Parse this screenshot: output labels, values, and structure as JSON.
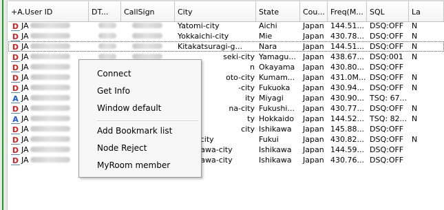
{
  "columns": [
    "+A.User ID",
    "DT...",
    "CallSign",
    "City",
    "State",
    "Cou...",
    "Freq(M...",
    "SQL",
    "La"
  ],
  "rows": [
    {
      "icon": "D",
      "id": "JA",
      "city": "Yatomi-city",
      "state": "Aichi",
      "country": "Japan",
      "freq": "144.51...",
      "sql": "DSQ:OFF",
      "last": "N"
    },
    {
      "icon": "D",
      "id": "JA",
      "city": "Yokkaichi-city",
      "state": "Mie",
      "country": "Japan",
      "freq": "430.78...",
      "sql": "DSQ:OFF",
      "last": "N"
    },
    {
      "icon": "D",
      "id": "JA",
      "city": "Kitakatsuragi-g...",
      "state": "Nara",
      "country": "Japan",
      "freq": "144.51...",
      "sql": "DSQ:OFF",
      "last": "N"
    },
    {
      "icon": "D",
      "id": "JA",
      "city": "seki-city",
      "state": "Yamagu...",
      "country": "Japan",
      "freq": "438.67...",
      "sql": "DSQ:001",
      "last": "N"
    },
    {
      "icon": "D",
      "id": "JA",
      "city": "n",
      "state": "Okayama",
      "country": "Japan",
      "freq": "430.80...",
      "sql": "DSQ:OFF",
      "last": ""
    },
    {
      "icon": "D",
      "id": "JA",
      "city": "oto-city",
      "state": "Kumam...",
      "country": "Japan",
      "freq": "431.0M...",
      "sql": "DSQ:OFF",
      "last": "N"
    },
    {
      "icon": "D",
      "id": "JA",
      "city": "-city",
      "state": "Fukuoka",
      "country": "Japan",
      "freq": "430.94...",
      "sql": "DSQ:OFF",
      "last": "N"
    },
    {
      "icon": "A",
      "id": "JA",
      "city": "ity",
      "state": "Miyagi",
      "country": "Japan",
      "freq": "430.90...",
      "sql": "TSQ: 67...",
      "last": ""
    },
    {
      "icon": "D",
      "id": "JA",
      "city": "na-city",
      "state": "Fukushi...",
      "country": "Japan",
      "freq": "430.77...",
      "sql": "DSQ:OFF",
      "last": "N"
    },
    {
      "icon": "A",
      "id": "JA",
      "city": "ty",
      "state": "Hokkaido",
      "country": "Japan",
      "freq": "144.52...",
      "sql": "TSQ: 82...",
      "last": "N"
    },
    {
      "icon": "D",
      "id": "JA",
      "city": "city",
      "state": "Ishikawa",
      "country": "Japan",
      "freq": "145.88...",
      "sql": "DSQ:OFF",
      "last": ""
    },
    {
      "icon": "D",
      "id": "JA",
      "city": "Fukui-city",
      "state": "Fukui",
      "country": "Japan",
      "freq": "430.82...",
      "sql": "DSQ:OFF",
      "last": "N"
    },
    {
      "icon": "D",
      "id": "JA",
      "city": "Kanazawa-city",
      "state": "Ishikawa",
      "country": "Japan",
      "freq": "144.59...",
      "sql": "DSQ:OFF",
      "last": ""
    },
    {
      "icon": "D",
      "id": "JA",
      "city": "Kanazawa-city",
      "state": "Ishikawa",
      "country": "Japan",
      "freq": "430.76...",
      "sql": "DSQ:OFF",
      "last": ""
    }
  ],
  "context_menu": {
    "items": [
      "Connect",
      "Get Info",
      "Window default",
      "Add Bookmark list",
      "Node Reject",
      "MyRoom member"
    ]
  },
  "colors": {
    "d_icon": "#e11b1b",
    "a_icon": "#1b58e1",
    "icon_underline": "#4a86d1"
  }
}
